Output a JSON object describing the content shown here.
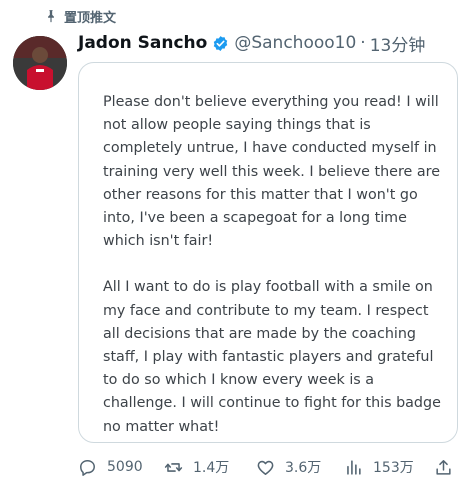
{
  "pinned": {
    "label": "置顶推文",
    "icon": "pin-icon"
  },
  "author": {
    "display_name": "Jadon Sancho",
    "verified": true,
    "verified_color": "#1d9bf0",
    "handle": "@Sanchooo10",
    "separator": "·",
    "time": "13分钟"
  },
  "tweet": {
    "paragraphs": [
      "Please don't believe everything you read! I will not allow people saying things that is completely untrue, I have conducted myself in training very well this week. I believe there are other reasons for this matter that I won't go into, I've been a scapegoat for a long time which isn't fair!",
      "All I want to do is play football with a smile on my face and contribute to my team. I respect all decisions that are made by the coaching staff, I play with fantastic players and grateful to do so which I know every week is a challenge. I will continue to fight for this badge no matter what!"
    ]
  },
  "actions": {
    "reply": {
      "icon": "reply-icon",
      "count": "5090"
    },
    "retweet": {
      "icon": "retweet-icon",
      "count": "1.4万"
    },
    "like": {
      "icon": "heart-icon",
      "count": "3.6万"
    },
    "views": {
      "icon": "views-icon",
      "count": "153万"
    },
    "share": {
      "icon": "share-icon"
    }
  },
  "colors": {
    "text_primary": "#0f1419",
    "text_secondary": "#536471",
    "border": "#cfd9de"
  }
}
